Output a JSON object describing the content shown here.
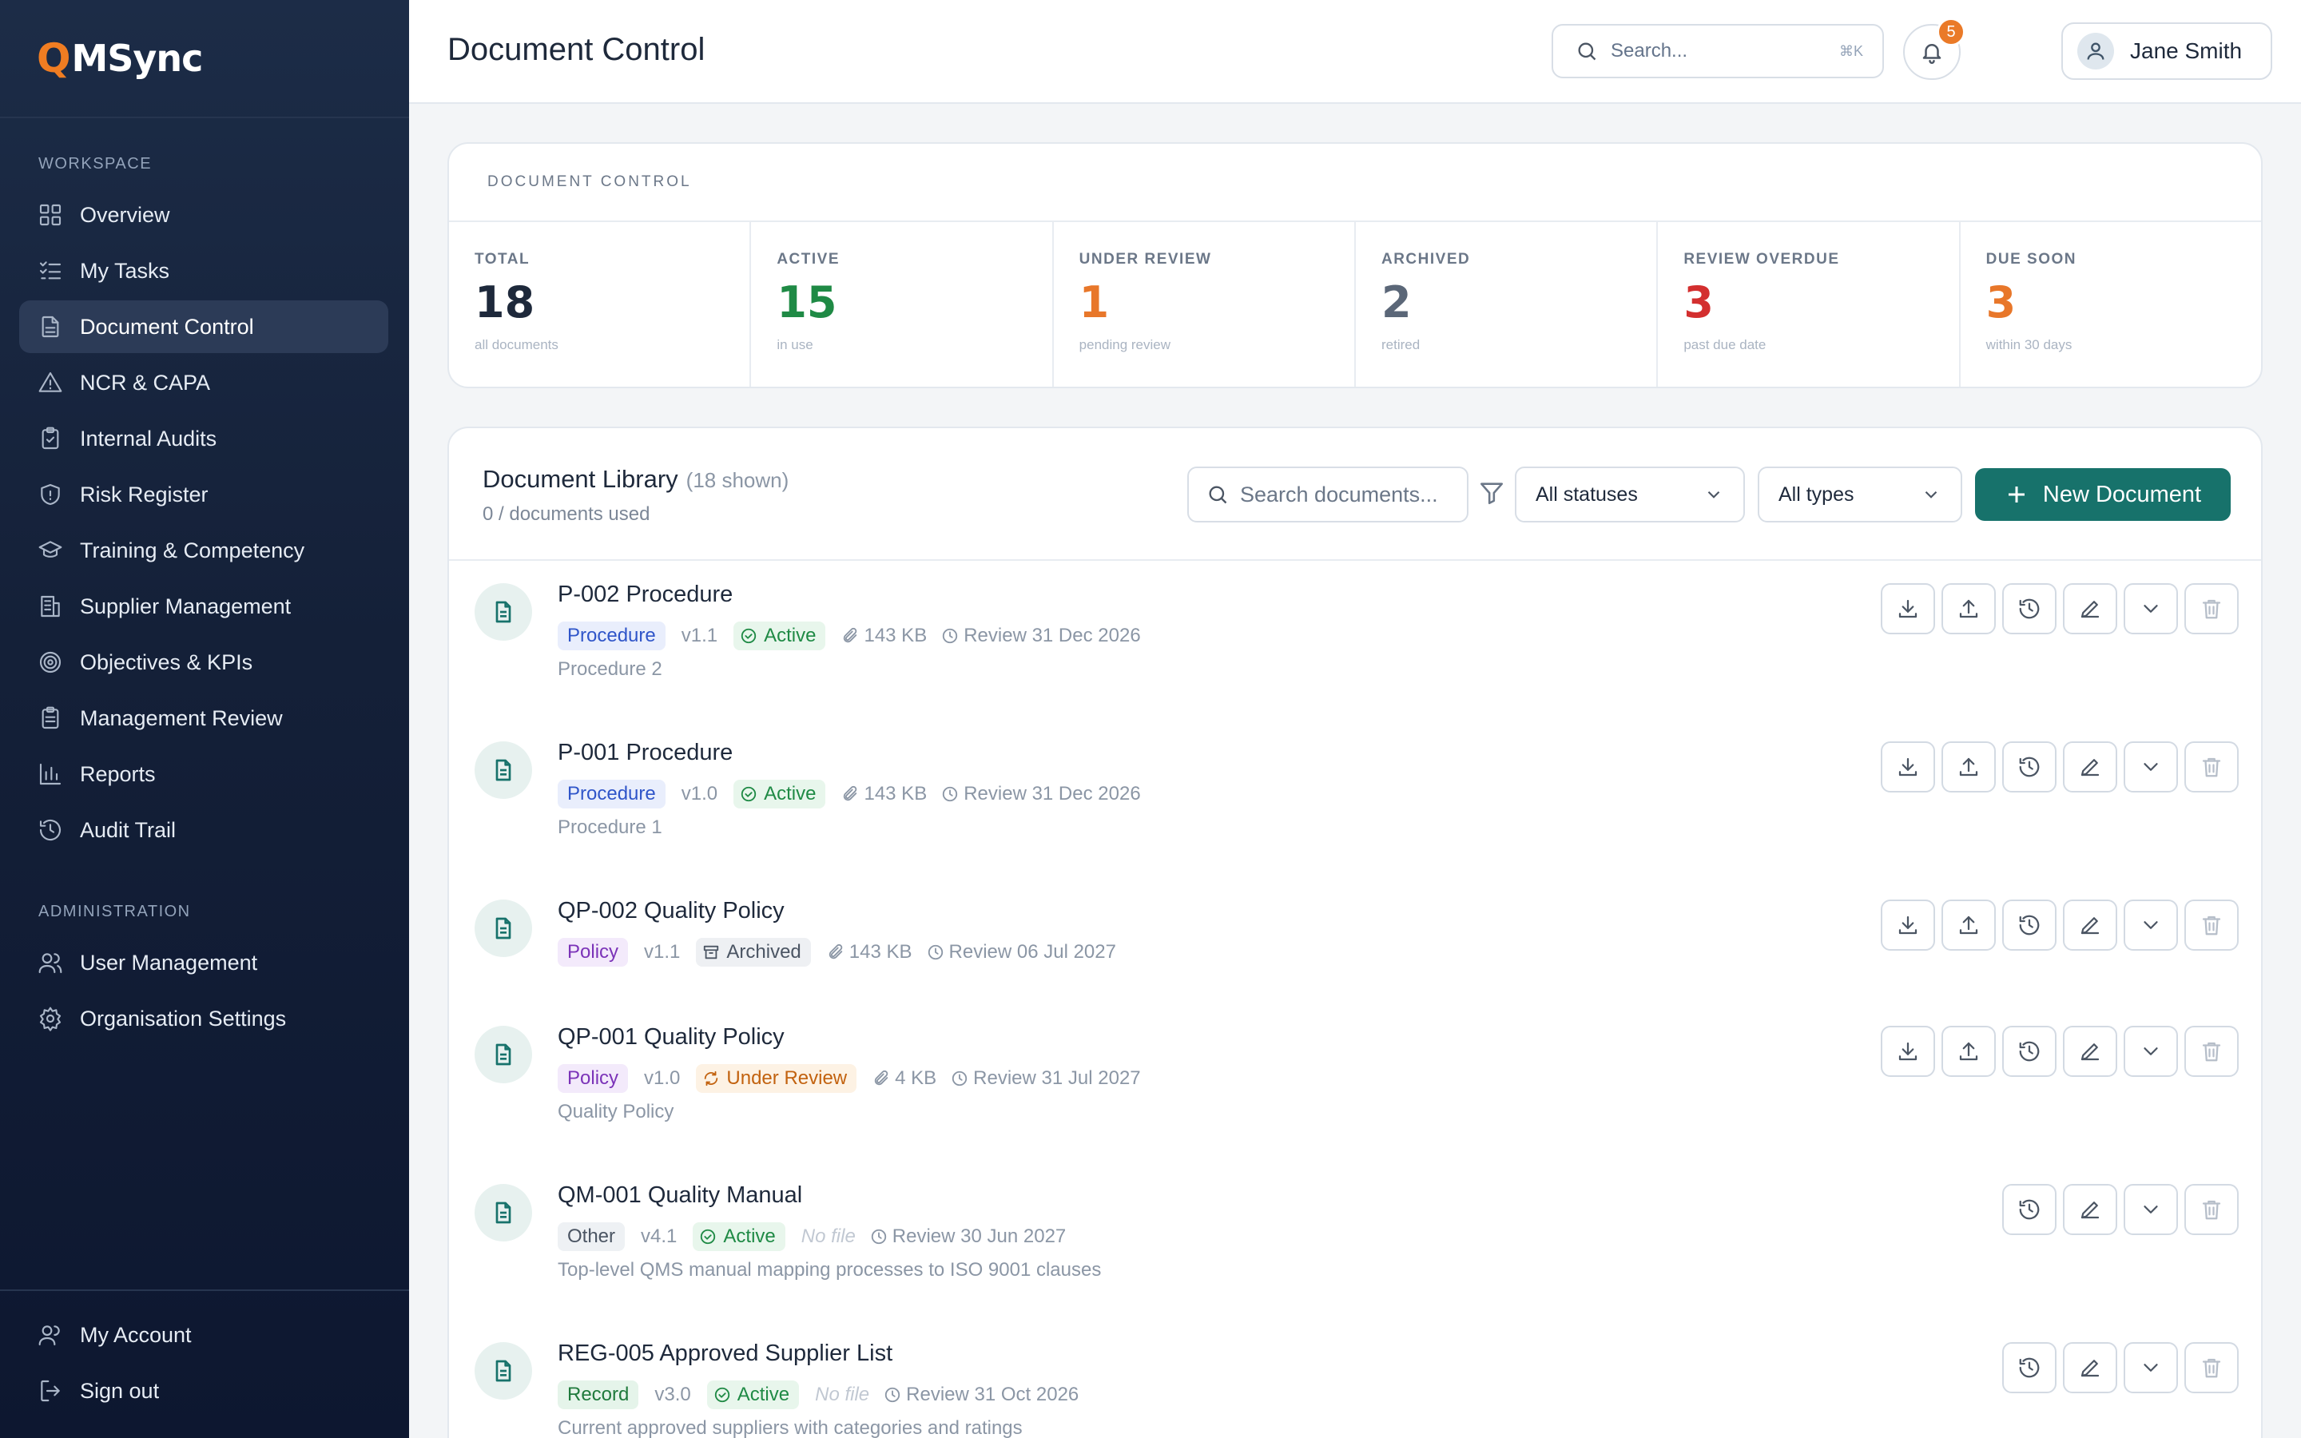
{
  "brand": {
    "q": "Q",
    "name": "MSync",
    "accent": "#f07d22"
  },
  "sidebar": {
    "workspace_title": "WORKSPACE",
    "admin_title": "ADMINISTRATION",
    "items": [
      {
        "label": "Overview",
        "icon": "grid-icon"
      },
      {
        "label": "My Tasks",
        "icon": "checklist-icon"
      },
      {
        "label": "Document Control",
        "icon": "document-icon",
        "active": true
      },
      {
        "label": "NCR & CAPA",
        "icon": "warning-icon"
      },
      {
        "label": "Internal Audits",
        "icon": "clipboard-check-icon"
      },
      {
        "label": "Risk Register",
        "icon": "shield-icon"
      },
      {
        "label": "Training & Competency",
        "icon": "graduation-cap-icon"
      },
      {
        "label": "Supplier Management",
        "icon": "building-icon"
      },
      {
        "label": "Objectives & KPIs",
        "icon": "target-icon"
      },
      {
        "label": "Management Review",
        "icon": "clipboard-icon"
      },
      {
        "label": "Reports",
        "icon": "bar-chart-icon"
      },
      {
        "label": "Audit Trail",
        "icon": "history-icon"
      }
    ],
    "admin_items": [
      {
        "label": "User Management",
        "icon": "users-icon"
      },
      {
        "label": "Organisation Settings",
        "icon": "gear-icon"
      }
    ],
    "bottom_items": [
      {
        "label": "My Account",
        "icon": "user-icon"
      },
      {
        "label": "Sign out",
        "icon": "sign-out-icon"
      }
    ]
  },
  "header": {
    "title": "Document Control",
    "search_placeholder": "Search...",
    "search_shortcut": "⌘K",
    "notification_count": "5",
    "user_name": "Jane Smith"
  },
  "stats": {
    "heading": "DOCUMENT CONTROL",
    "items": [
      {
        "label": "TOTAL",
        "value": "18",
        "sub": "all documents",
        "color": "#1e293b"
      },
      {
        "label": "ACTIVE",
        "value": "15",
        "sub": "in use",
        "color": "#1f8a45"
      },
      {
        "label": "UNDER REVIEW",
        "value": "1",
        "sub": "pending review",
        "color": "#e8772a"
      },
      {
        "label": "ARCHIVED",
        "value": "2",
        "sub": "retired",
        "color": "#5b6778"
      },
      {
        "label": "REVIEW OVERDUE",
        "value": "3",
        "sub": "past due date",
        "color": "#d32f2f"
      },
      {
        "label": "DUE SOON",
        "value": "3",
        "sub": "within 30 days",
        "color": "#e8772a"
      }
    ]
  },
  "library": {
    "title": "Document Library",
    "count": "(18 shown)",
    "usage": "0 / documents used",
    "search_placeholder": "Search documents...",
    "status_filter": "All statuses",
    "type_filter": "All types",
    "new_button": "New Document",
    "documents": [
      {
        "title": "P-002 Procedure",
        "type": "Procedure",
        "version": "v1.1",
        "status": "Active",
        "size": "143 KB",
        "review": "Review 31 Dec 2026",
        "description": "Procedure 2"
      },
      {
        "title": "P-001 Procedure",
        "type": "Procedure",
        "version": "v1.0",
        "status": "Active",
        "size": "143 KB",
        "review": "Review 31 Dec 2026",
        "description": "Procedure 1"
      },
      {
        "title": "QP-002 Quality Policy",
        "type": "Policy",
        "version": "v1.1",
        "status": "Archived",
        "size": "143 KB",
        "review": "Review 06 Jul 2027",
        "description": ""
      },
      {
        "title": "QP-001 Quality Policy",
        "type": "Policy",
        "version": "v1.0",
        "status": "Under Review",
        "size": "4 KB",
        "review": "Review 31 Jul 2027",
        "description": "Quality Policy"
      },
      {
        "title": "QM-001 Quality Manual",
        "type": "Other",
        "version": "v4.1",
        "status": "Active",
        "size": "No file",
        "review": "Review 30 Jun 2027",
        "description": "Top-level QMS manual mapping processes to ISO 9001 clauses"
      },
      {
        "title": "REG-005 Approved Supplier List",
        "type": "Record",
        "version": "v3.0",
        "status": "Active",
        "size": "No file",
        "review": "Review 31 Oct 2026",
        "description": "Current approved suppliers with categories and ratings"
      }
    ]
  }
}
